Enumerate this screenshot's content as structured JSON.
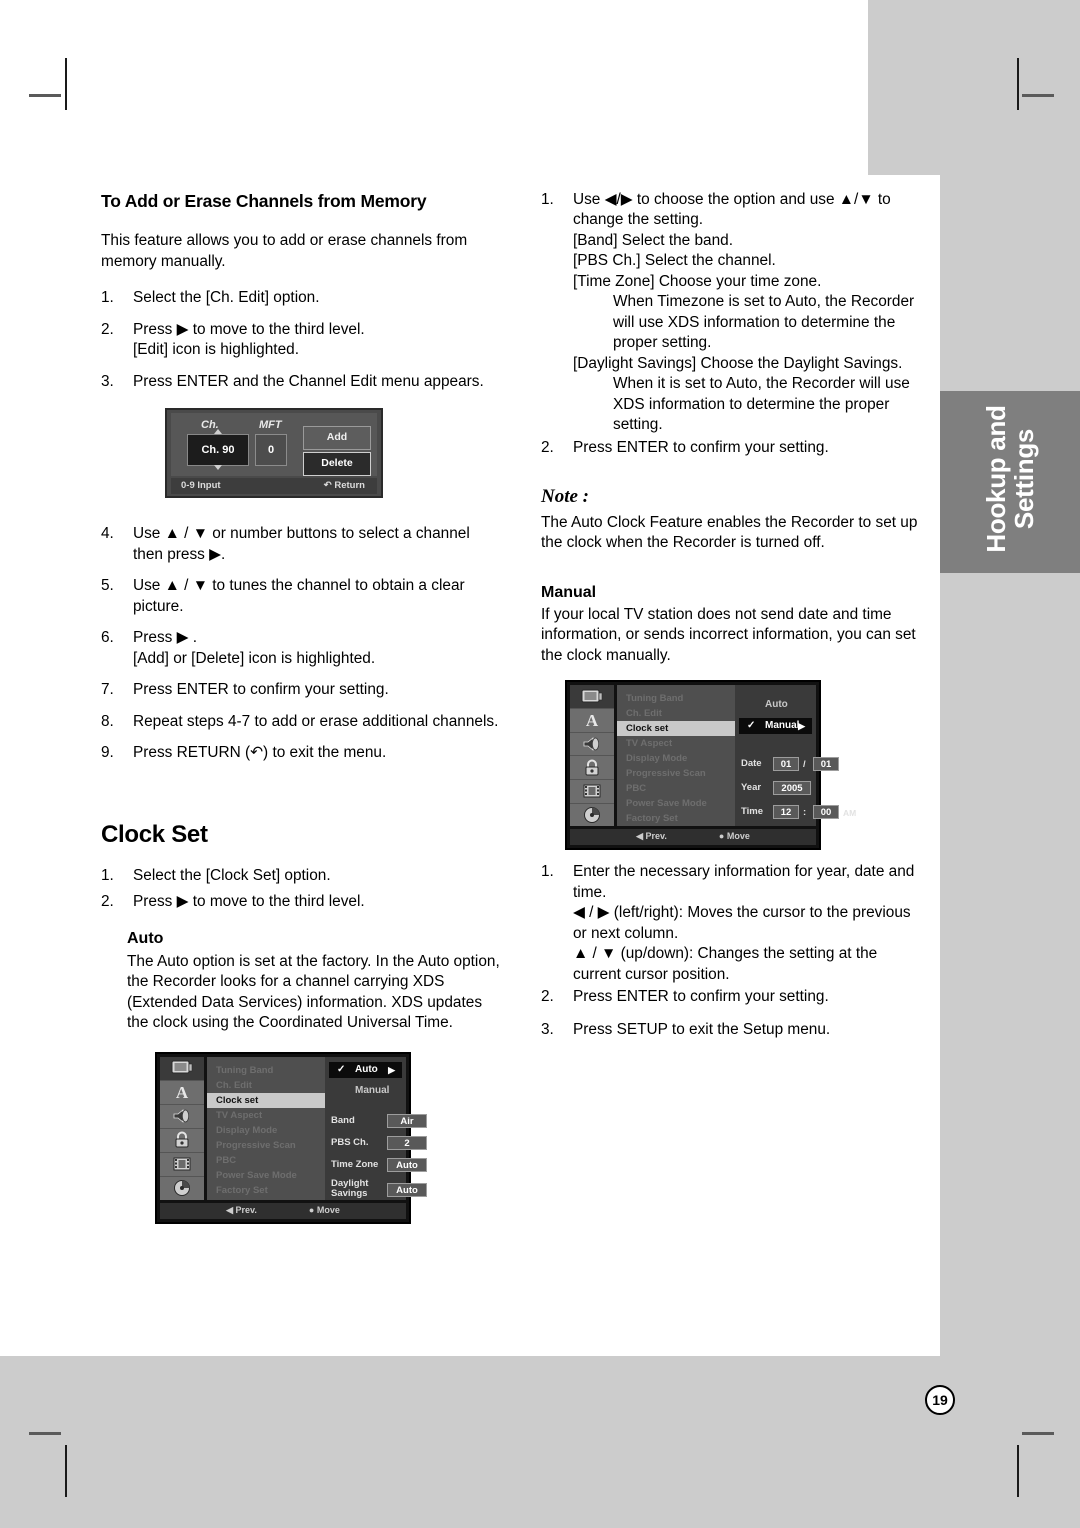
{
  "page": {
    "number": "19",
    "side_tab": "Hookup and\nSettings"
  },
  "left_column": {
    "heading": "To Add or Erase Channels from Memory",
    "intro": "This feature allows you to add or erase channels from memory manually.",
    "steps_a": [
      {
        "num": "1.",
        "text": "Select the [Ch. Edit] option."
      },
      {
        "num": "2.",
        "text": "Press ▶ to move to the third level.",
        "sub": "[Edit] icon is highlighted."
      },
      {
        "num": "3.",
        "text": "Press ENTER and the Channel Edit menu appears."
      }
    ],
    "ch_edit_osd": {
      "label_ch": "Ch.",
      "label_mft": "MFT",
      "value_ch": "Ch. 90",
      "value_mft": "0",
      "button_add": "Add",
      "button_delete": "Delete",
      "footer_left": "0-9 Input",
      "footer_right": "Return"
    },
    "steps_b": [
      {
        "num": "4.",
        "text": "Use ▲ / ▼ or number buttons to select a channel then press ▶."
      },
      {
        "num": "5.",
        "text": "Use ▲ / ▼ to tunes the channel to obtain a clear picture."
      },
      {
        "num": "6.",
        "text": "Press ▶ .",
        "sub": "[Add] or [Delete] icon is highlighted."
      },
      {
        "num": "7.",
        "text": "Press ENTER to confirm your setting."
      },
      {
        "num": "8.",
        "text": "Repeat steps 4-7 to add or erase additional channels."
      },
      {
        "num": "9.",
        "text": "Press RETURN (↶) to exit the menu."
      }
    ],
    "clock_set_title": "Clock Set",
    "steps_c": [
      {
        "num": "1.",
        "text": "Select the [Clock Set] option."
      },
      {
        "num": "2.",
        "text": "Press ▶ to move to the third level."
      }
    ],
    "auto_title": "Auto",
    "auto_body": "The Auto option is set at the factory. In the Auto option, the Recorder looks for a channel carrying XDS (Extended Data Services) information. XDS updates the clock using the Coordinated Universal Time.",
    "auto_osd": {
      "menu_items": [
        "Tuning Band",
        "Ch. Edit",
        "Clock set",
        "TV Aspect",
        "Display Mode",
        "Progressive Scan",
        "PBC",
        "Power Save Mode",
        "Factory Set"
      ],
      "selected_menu_index": 2,
      "options": [
        {
          "label": "Auto",
          "checked": true,
          "highlighted": true,
          "chevron": true
        },
        {
          "label": "Manual",
          "checked": false,
          "highlighted": false,
          "chevron": false
        }
      ],
      "fields": [
        {
          "name": "Band",
          "value": "Air"
        },
        {
          "name": "PBS Ch.",
          "value": "2"
        },
        {
          "name": "Time Zone",
          "value": "Auto"
        },
        {
          "name": "Daylight Savings",
          "value": "Auto"
        }
      ],
      "status_prev": "Prev.",
      "status_move": "Move"
    }
  },
  "right_column": {
    "steps_d": [
      {
        "num": "1.",
        "text": "Use ◀/▶ to choose the option and use ▲/▼  to change the setting.",
        "lines": [
          {
            "indent": 1,
            "text": "[Band] Select the band."
          },
          {
            "indent": 1,
            "text": "[PBS Ch.] Select the channel."
          },
          {
            "indent": 1,
            "text": "[Time Zone] Choose your time zone."
          },
          {
            "indent": 2,
            "text": "When Timezone is set to Auto, the Recorder will use XDS information to determine the proper setting."
          },
          {
            "indent": 1,
            "text": "[Daylight Savings] Choose the Daylight Savings."
          },
          {
            "indent": 2,
            "text": "When it is set to Auto, the Recorder will use XDS information to determine the proper setting."
          }
        ]
      },
      {
        "num": "2.",
        "text": "Press ENTER to confirm your setting.",
        "lines": []
      }
    ],
    "note_heading": "Note :",
    "note_body": "The Auto Clock Feature enables the Recorder to set up the clock when the Recorder is turned off.",
    "manual_title": "Manual",
    "manual_body": "If your local TV station does not send date and time information, or sends incorrect information, you can set the clock manually.",
    "manual_osd": {
      "menu_items": [
        "Tuning Band",
        "Ch. Edit",
        "Clock set",
        "TV Aspect",
        "Display Mode",
        "Progressive Scan",
        "PBC",
        "Power Save Mode",
        "Factory Set"
      ],
      "selected_menu_index": 2,
      "options": [
        {
          "label": "Auto",
          "checked": false,
          "highlighted": false,
          "chevron": false
        },
        {
          "label": "Manual",
          "checked": true,
          "highlighted": true,
          "chevron": true
        }
      ],
      "fields": [
        {
          "name": "Date",
          "value1": "01",
          "sep": "/",
          "value2": "01"
        },
        {
          "name": "Year",
          "value1": "2005"
        },
        {
          "name": "Time",
          "value1": "12",
          "sep": ":",
          "value2": "00",
          "suffix": "AM"
        }
      ],
      "status_prev": "Prev.",
      "status_move": "Move"
    },
    "steps_e": [
      {
        "num": "1.",
        "text": "Enter the necessary information for year, date and time.",
        "lines": [
          {
            "indent": 0,
            "text": "◀ / ▶ (left/right): Moves the cursor to the previous or next column."
          },
          {
            "indent": 0,
            "text": "▲ / ▼ (up/down): Changes the setting at the current cursor position."
          }
        ]
      },
      {
        "num": "2.",
        "text": "Press ENTER to confirm your setting.",
        "lines": []
      }
    ],
    "final_step": {
      "num": "3.",
      "text": "Press SETUP to exit the Setup menu."
    }
  },
  "colors": {
    "page_gray": "#cccccc",
    "tab_gray": "#7f7f7f",
    "text": "#000000"
  }
}
